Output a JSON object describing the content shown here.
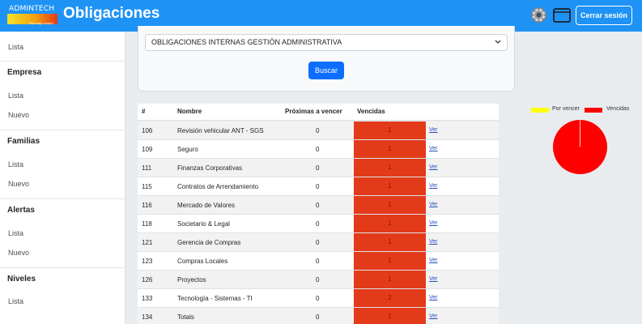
{
  "header": {
    "logo_text": "ADMINTECH",
    "logo_subtext": "Todo bajo control",
    "title": "Obligaciones",
    "logout_label": "Cerrar sesión"
  },
  "sidebar": {
    "items": [
      {
        "type": "link",
        "label": "Lista"
      },
      {
        "type": "section",
        "label": "Empresa"
      },
      {
        "type": "link",
        "label": "Lista"
      },
      {
        "type": "link",
        "label": "Nuevo"
      },
      {
        "type": "section",
        "label": "Familias"
      },
      {
        "type": "link",
        "label": "Lista"
      },
      {
        "type": "link",
        "label": "Nuevo"
      },
      {
        "type": "section",
        "label": "Alertas"
      },
      {
        "type": "link",
        "label": "Lista"
      },
      {
        "type": "link",
        "label": "Nuevo"
      },
      {
        "type": "section",
        "label": "Niveles"
      },
      {
        "type": "link",
        "label": "Lista"
      }
    ]
  },
  "filter": {
    "selected": "OBLIGACIONES INTERNAS GESTIÓN ADMINISTRATIVA",
    "button_label": "Buscar"
  },
  "table": {
    "headers": [
      "#",
      "Nombre",
      "Próximas a vencer",
      "Vencidas"
    ],
    "link_label": "Ver",
    "rows": [
      {
        "id": "106",
        "name": "Revisión vehicular ANT - SGS",
        "proximas": "0",
        "vencidas": "1"
      },
      {
        "id": "109",
        "name": "Seguro",
        "proximas": "0",
        "vencidas": "1"
      },
      {
        "id": "111",
        "name": "Finanzas Corporativas",
        "proximas": "0",
        "vencidas": "1"
      },
      {
        "id": "115",
        "name": "Contratos de Arrendamiento",
        "proximas": "0",
        "vencidas": "1"
      },
      {
        "id": "116",
        "name": "Mercado de Valores",
        "proximas": "0",
        "vencidas": "1"
      },
      {
        "id": "118",
        "name": "Societario & Legal",
        "proximas": "0",
        "vencidas": "1"
      },
      {
        "id": "121",
        "name": "Gerencia de Compras",
        "proximas": "0",
        "vencidas": "1"
      },
      {
        "id": "123",
        "name": "Compras Locales",
        "proximas": "0",
        "vencidas": "1"
      },
      {
        "id": "126",
        "name": "Proyectos",
        "proximas": "0",
        "vencidas": "1"
      },
      {
        "id": "133",
        "name": "Tecnología - Sistemas - TI",
        "proximas": "0",
        "vencidas": "2"
      },
      {
        "id": "134",
        "name": "Totals",
        "proximas": "0",
        "vencidas": "1"
      }
    ]
  },
  "chart_data": {
    "type": "pie",
    "legend_position": "top",
    "series": [
      {
        "name": "Por vencer",
        "value": 0,
        "color": "#ffff00"
      },
      {
        "name": "Vencidas",
        "value": 12,
        "color": "#ff0000"
      }
    ]
  },
  "colors": {
    "header_bg": "#1f93f5",
    "vencidas_cell": "#e33b19",
    "primary_button": "#0d6efd"
  }
}
